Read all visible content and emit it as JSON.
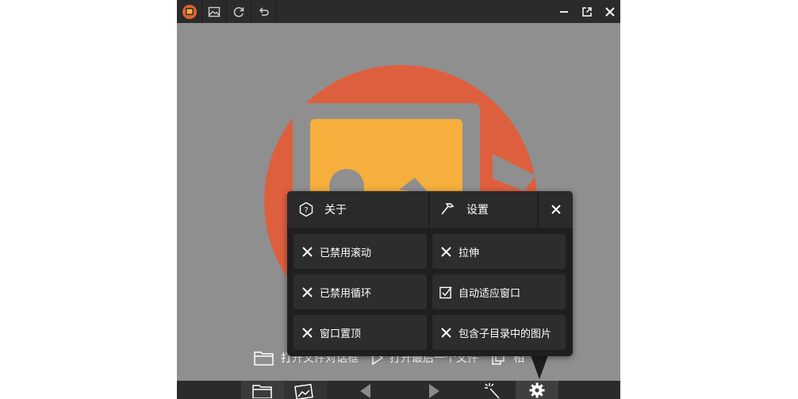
{
  "titlebar": {
    "buttons": [
      "app-logo",
      "image-icon",
      "refresh-icon",
      "undo-icon"
    ],
    "window_controls": [
      "minimize",
      "restore",
      "close"
    ]
  },
  "hints": {
    "open_dialog": "打开文件对话框",
    "open_last": "打开最后一个文件",
    "third_partial": "相"
  },
  "popup": {
    "about_label": "关于",
    "settings_label": "设置",
    "options": [
      {
        "label": "已禁用滚动",
        "state": "off"
      },
      {
        "label": "拉伸",
        "state": "off"
      },
      {
        "label": "已禁用循环",
        "state": "off"
      },
      {
        "label": "自动适应窗口",
        "state": "on"
      },
      {
        "label": "窗口置顶",
        "state": "off"
      },
      {
        "label": "包含子目录中的图片",
        "state": "off"
      }
    ]
  },
  "colors": {
    "bar": "#2b2b2b",
    "canvas": "#8f8f8f",
    "circle": "#de5f3e",
    "picture": "#f6ae3d",
    "popup": "#1f1f1f"
  }
}
